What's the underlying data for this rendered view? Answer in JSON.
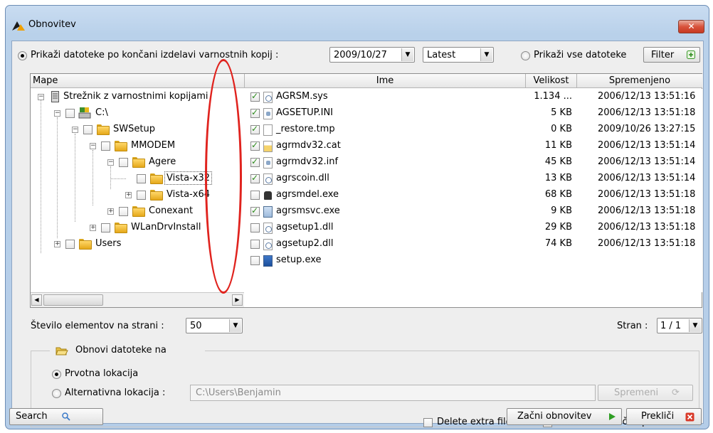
{
  "window": {
    "title": "Obnovitev",
    "close_label": "✕"
  },
  "filter_row": {
    "show_after_label": "Prikaži datoteke po končani izdelavi varnostnih kopij :",
    "date_value": "2009/10/27",
    "version_value": "Latest",
    "show_all_label": "Prikaži vse datoteke",
    "filter_button": "Filter"
  },
  "table": {
    "headers": {
      "folders": "Mape",
      "name": "Ime",
      "size": "Velikost",
      "modified": "Spremenjeno"
    }
  },
  "tree": [
    {
      "label": "Strežnik z varnostnimi kopijami",
      "checked": false
    },
    {
      "label": "C:\\",
      "checked": false
    },
    {
      "label": "SWSetup",
      "checked": false
    },
    {
      "label": "MMODEM",
      "checked": false
    },
    {
      "label": "Agere",
      "checked": false
    },
    {
      "label": "Vista-x32",
      "checked": false
    },
    {
      "label": "Vista-x64",
      "checked": false
    },
    {
      "label": "Conexant",
      "checked": false
    },
    {
      "label": "WLanDrvInstall",
      "checked": false
    },
    {
      "label": "Users",
      "checked": false
    }
  ],
  "files": [
    {
      "name": "AGRSM.sys",
      "size": "1.134 ...",
      "modified": "2006/12/13 13:51:16",
      "checked": true,
      "icon": "sys-file-icon"
    },
    {
      "name": "AGSETUP.INI",
      "size": "5 KB",
      "modified": "2006/12/13 13:51:18",
      "checked": true,
      "icon": "ini-file-icon"
    },
    {
      "name": "_restore.tmp",
      "size": "0 KB",
      "modified": "2009/10/26 13:27:15",
      "checked": true,
      "icon": "tmp-file-icon"
    },
    {
      "name": "agrmdv32.cat",
      "size": "11 KB",
      "modified": "2006/12/13 13:51:14",
      "checked": true,
      "icon": "cat-file-icon"
    },
    {
      "name": "agrmdv32.inf",
      "size": "45 KB",
      "modified": "2006/12/13 13:51:14",
      "checked": true,
      "icon": "inf-file-icon"
    },
    {
      "name": "agrscoin.dll",
      "size": "13 KB",
      "modified": "2006/12/13 13:51:14",
      "checked": true,
      "icon": "dll-file-icon"
    },
    {
      "name": "agrsmdel.exe",
      "size": "68 KB",
      "modified": "2006/12/13 13:51:18",
      "checked": false,
      "icon": "exe-file-icon"
    },
    {
      "name": "agrsmsvc.exe",
      "size": "9 KB",
      "modified": "2006/12/13 13:51:18",
      "checked": true,
      "icon": "exe-file-icon"
    },
    {
      "name": "agsetup1.dll",
      "size": "29 KB",
      "modified": "2006/12/13 13:51:18",
      "checked": false,
      "icon": "dll-file-icon"
    },
    {
      "name": "agsetup2.dll",
      "size": "74 KB",
      "modified": "2006/12/13 13:51:18",
      "checked": false,
      "icon": "dll-file-icon"
    },
    {
      "name": "setup.exe",
      "size": "",
      "modified": "",
      "checked": false,
      "icon": "setup-exe-icon"
    }
  ],
  "paging": {
    "per_page_label": "Število elementov na strani :",
    "per_page_value": "50",
    "page_label": "Stran :",
    "page_value": "1 / 1"
  },
  "restore": {
    "group_label": "Obnovi datoteke na",
    "original_label": "Prvotna lokacija",
    "alternative_label": "Alternativna lokacija :",
    "alternative_path": "C:\\Users\\Benjamin",
    "change_button": "Spremeni"
  },
  "options": {
    "delete_extra": "Delete extra files",
    "restore_permissions": "Obnovi datotečne pravice."
  },
  "footer": {
    "search_button": "Search",
    "start_button": "Začni obnovitev",
    "cancel_button": "Prekliči"
  }
}
